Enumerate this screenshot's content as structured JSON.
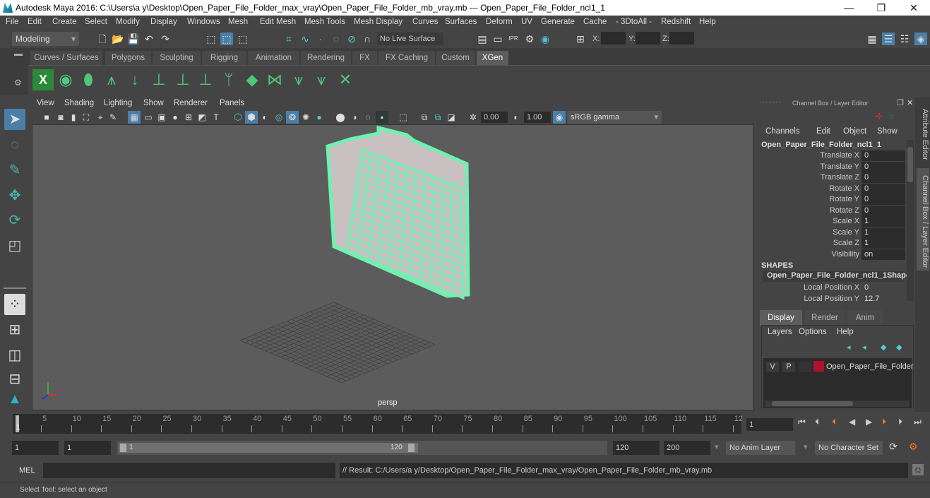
{
  "window": {
    "title": "Autodesk Maya 2016: C:\\Users\\a y\\Desktop\\Open_Paper_File_Folder_max_vray\\Open_Paper_File_Folder_mb_vray.mb  ---  Open_Paper_File_Folder_ncl1_1",
    "min": "—",
    "max": "❐",
    "close": "✕"
  },
  "menubar": [
    "File",
    "Edit",
    "Create",
    "Select",
    "Modify",
    "Display",
    "Windows",
    "Mesh",
    "Edit Mesh",
    "Mesh Tools",
    "Mesh Display",
    "Curves",
    "Surfaces",
    "Deform",
    "UV",
    "Generate",
    "Cache",
    "- 3DtoAll -",
    "Redshift",
    "Help"
  ],
  "statusline": {
    "mode": "Modeling",
    "live_surface": "No Live Surface",
    "x_label": "X:",
    "y_label": "Y:",
    "z_label": "Z:",
    "x": "",
    "y": "",
    "z": ""
  },
  "shelf_tabs": [
    "Curves / Surfaces",
    "Polygons",
    "Sculpting",
    "Rigging",
    "Animation",
    "Rendering",
    "FX",
    "FX Caching",
    "Custom",
    "XGen"
  ],
  "shelf_active": "XGen",
  "viewport": {
    "menus": [
      "View",
      "Shading",
      "Lighting",
      "Show",
      "Renderer",
      "Panels"
    ],
    "exposure": "0.00",
    "gamma": "1.00",
    "colorspace": "sRGB gamma",
    "camera": "persp"
  },
  "channelbox": {
    "title": "Channel Box / Layer Editor",
    "menus": [
      "Channels",
      "Edit",
      "Object",
      "Show"
    ],
    "object": "Open_Paper_File_Folder_ncl1_1",
    "attrs": [
      {
        "label": "Translate X",
        "value": "0"
      },
      {
        "label": "Translate Y",
        "value": "0"
      },
      {
        "label": "Translate Z",
        "value": "0"
      },
      {
        "label": "Rotate X",
        "value": "0"
      },
      {
        "label": "Rotate Y",
        "value": "0"
      },
      {
        "label": "Rotate Z",
        "value": "0"
      },
      {
        "label": "Scale X",
        "value": "1"
      },
      {
        "label": "Scale Y",
        "value": "1"
      },
      {
        "label": "Scale Z",
        "value": "1"
      },
      {
        "label": "Visibility",
        "value": "on"
      }
    ],
    "shapes_header": "SHAPES",
    "shape": "Open_Paper_File_Folder_ncl1_1Shape",
    "shape_attrs": [
      {
        "label": "Local Position X",
        "value": "0"
      },
      {
        "label": "Local Position Y",
        "value": "12.7"
      }
    ]
  },
  "sidetabs": [
    "Attribute Editor",
    "Channel Box / Layer Editor"
  ],
  "layers": {
    "tabs": [
      "Display",
      "Render",
      "Anim"
    ],
    "active": "Display",
    "menus": [
      "Layers",
      "Options",
      "Help"
    ],
    "layer": {
      "v": "V",
      "p": "P",
      "name": "Open_Paper_File_Folder",
      "color": "#b0122e"
    }
  },
  "timeline": {
    "ticks": [
      "5",
      "10",
      "15",
      "20",
      "25",
      "30",
      "35",
      "40",
      "45",
      "50",
      "55",
      "60",
      "65",
      "70",
      "75",
      "80",
      "85",
      "90",
      "95",
      "100",
      "105",
      "110",
      "115",
      "12"
    ],
    "current_marker": "1",
    "current_frame": "1"
  },
  "range": {
    "start": "1",
    "anim_start": "1",
    "slider_start": "1",
    "slider_end": "120",
    "anim_end": "120",
    "end": "200",
    "anim_layer": "No Anim Layer",
    "char_set": "No Character Set"
  },
  "cmdline": {
    "label": "MEL",
    "input": "",
    "result": "// Result: C:/Users/a y/Desktop/Open_Paper_File_Folder_max_vray/Open_Paper_File_Folder_mb_vray.mb"
  },
  "helpline": "Select Tool: select an object"
}
